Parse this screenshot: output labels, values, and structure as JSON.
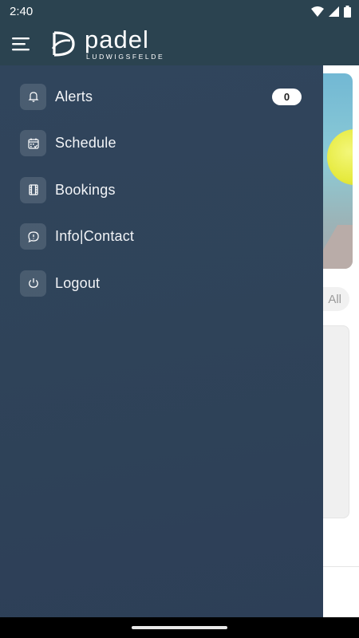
{
  "status": {
    "time": "2:40"
  },
  "app": {
    "logo_word": "padel",
    "logo_sub": "LUDWIGSFELDE"
  },
  "background": {
    "filter_chip": "All"
  },
  "drawer": {
    "items": [
      {
        "label": "Alerts",
        "icon": "bell-icon",
        "badge": "0"
      },
      {
        "label": "Schedule",
        "icon": "calendar-icon"
      },
      {
        "label": "Bookings",
        "icon": "film-icon"
      },
      {
        "label": "Info|Contact",
        "icon": "chat-info-icon"
      },
      {
        "label": "Logout",
        "icon": "power-icon"
      }
    ]
  },
  "colors": {
    "appbar": "#2b4350",
    "drawer": "#2f4359",
    "ball": "#e6ea3e"
  }
}
